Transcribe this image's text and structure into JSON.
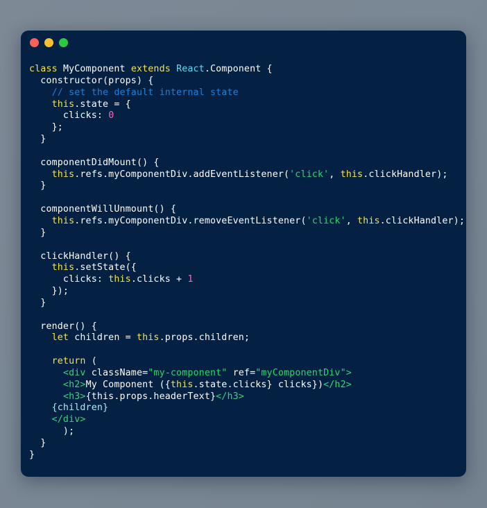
{
  "window": {
    "title": "code-snippet-window",
    "background_color": "#042144",
    "page_background": "#7a8794",
    "controls": [
      {
        "name": "close",
        "label": "",
        "color": "#fc6058"
      },
      {
        "name": "minimize",
        "label": "",
        "color": "#fec02f"
      },
      {
        "name": "maximize",
        "label": "",
        "color": "#2aca41"
      }
    ]
  },
  "theme": {
    "plain": "#fdfdfd",
    "keyword": "#f2e14c",
    "type": "#63d9f2",
    "comment": "#1f7fd6",
    "string": "#2fd46a",
    "number": "#f06ec1",
    "tag": "#3ed07a",
    "expression": "#aee9f5"
  },
  "code": {
    "language": "jsx",
    "lines": [
      [
        {
          "t": "class ",
          "c": "kw"
        },
        {
          "t": "MyComponent ",
          "c": "plain"
        },
        {
          "t": "extends ",
          "c": "kw"
        },
        {
          "t": "React",
          "c": "type"
        },
        {
          "t": ".Component {",
          "c": "plain"
        }
      ],
      [
        {
          "t": "  constructor(props) {",
          "c": "plain"
        }
      ],
      [
        {
          "t": "    ",
          "c": "plain"
        },
        {
          "t": "// set the default internal state",
          "c": "comment"
        }
      ],
      [
        {
          "t": "    ",
          "c": "plain"
        },
        {
          "t": "this",
          "c": "this"
        },
        {
          "t": ".state = {",
          "c": "plain"
        }
      ],
      [
        {
          "t": "      clicks: ",
          "c": "plain"
        },
        {
          "t": "0",
          "c": "num"
        }
      ],
      [
        {
          "t": "    };",
          "c": "plain"
        }
      ],
      [
        {
          "t": "  }",
          "c": "plain"
        }
      ],
      [
        {
          "t": "",
          "c": "plain"
        }
      ],
      [
        {
          "t": "  componentDidMount() {",
          "c": "plain"
        }
      ],
      [
        {
          "t": "    ",
          "c": "plain"
        },
        {
          "t": "this",
          "c": "this"
        },
        {
          "t": ".refs.myComponentDiv.addEventListener(",
          "c": "plain"
        },
        {
          "t": "'click'",
          "c": "str"
        },
        {
          "t": ", ",
          "c": "plain"
        },
        {
          "t": "this",
          "c": "this"
        },
        {
          "t": ".clickHandler);",
          "c": "plain"
        }
      ],
      [
        {
          "t": "  }",
          "c": "plain"
        }
      ],
      [
        {
          "t": "",
          "c": "plain"
        }
      ],
      [
        {
          "t": "  componentWillUnmount() {",
          "c": "plain"
        }
      ],
      [
        {
          "t": "    ",
          "c": "plain"
        },
        {
          "t": "this",
          "c": "this"
        },
        {
          "t": ".refs.myComponentDiv.removeEventListener(",
          "c": "plain"
        },
        {
          "t": "'click'",
          "c": "str"
        },
        {
          "t": ", ",
          "c": "plain"
        },
        {
          "t": "this",
          "c": "this"
        },
        {
          "t": ".clickHandler);",
          "c": "plain"
        }
      ],
      [
        {
          "t": "  }",
          "c": "plain"
        }
      ],
      [
        {
          "t": "",
          "c": "plain"
        }
      ],
      [
        {
          "t": "  clickHandler() {",
          "c": "plain"
        }
      ],
      [
        {
          "t": "    ",
          "c": "plain"
        },
        {
          "t": "this",
          "c": "this"
        },
        {
          "t": ".setState({",
          "c": "plain"
        }
      ],
      [
        {
          "t": "      clicks: ",
          "c": "plain"
        },
        {
          "t": "this",
          "c": "this"
        },
        {
          "t": ".clicks + ",
          "c": "plain"
        },
        {
          "t": "1",
          "c": "num"
        }
      ],
      [
        {
          "t": "    });",
          "c": "plain"
        }
      ],
      [
        {
          "t": "  }",
          "c": "plain"
        }
      ],
      [
        {
          "t": "",
          "c": "plain"
        }
      ],
      [
        {
          "t": "  render() {",
          "c": "plain"
        }
      ],
      [
        {
          "t": "    ",
          "c": "plain"
        },
        {
          "t": "let",
          "c": "kw"
        },
        {
          "t": " children = ",
          "c": "plain"
        },
        {
          "t": "this",
          "c": "this"
        },
        {
          "t": ".props.children;",
          "c": "plain"
        }
      ],
      [
        {
          "t": "",
          "c": "plain"
        }
      ],
      [
        {
          "t": "    ",
          "c": "plain"
        },
        {
          "t": "return",
          "c": "kw"
        },
        {
          "t": " (",
          "c": "plain"
        }
      ],
      [
        {
          "t": "      ",
          "c": "plain"
        },
        {
          "t": "<div",
          "c": "tag"
        },
        {
          "t": " className=",
          "c": "plain"
        },
        {
          "t": "\"my-component\"",
          "c": "str"
        },
        {
          "t": " ref=",
          "c": "plain"
        },
        {
          "t": "\"myComponentDiv\"",
          "c": "str"
        },
        {
          "t": ">",
          "c": "tag"
        }
      ],
      [
        {
          "t": "      ",
          "c": "plain"
        },
        {
          "t": "<h2>",
          "c": "tag"
        },
        {
          "t": "My Component ({",
          "c": "plain"
        },
        {
          "t": "this",
          "c": "this"
        },
        {
          "t": ".state.clicks} clicks})",
          "c": "plain"
        },
        {
          "t": "</h2>",
          "c": "tag"
        }
      ],
      [
        {
          "t": "      ",
          "c": "plain"
        },
        {
          "t": "<h3>",
          "c": "tag"
        },
        {
          "t": "{this.props.headerText}",
          "c": "plain"
        },
        {
          "t": "</h3>",
          "c": "tag"
        }
      ],
      [
        {
          "t": "    ",
          "c": "plain"
        },
        {
          "t": "{children}",
          "c": "expr"
        }
      ],
      [
        {
          "t": "    ",
          "c": "plain"
        },
        {
          "t": "</div>",
          "c": "tag"
        }
      ],
      [
        {
          "t": "      );",
          "c": "plain"
        }
      ],
      [
        {
          "t": "  }",
          "c": "plain"
        }
      ],
      [
        {
          "t": "}",
          "c": "plain"
        }
      ]
    ]
  }
}
